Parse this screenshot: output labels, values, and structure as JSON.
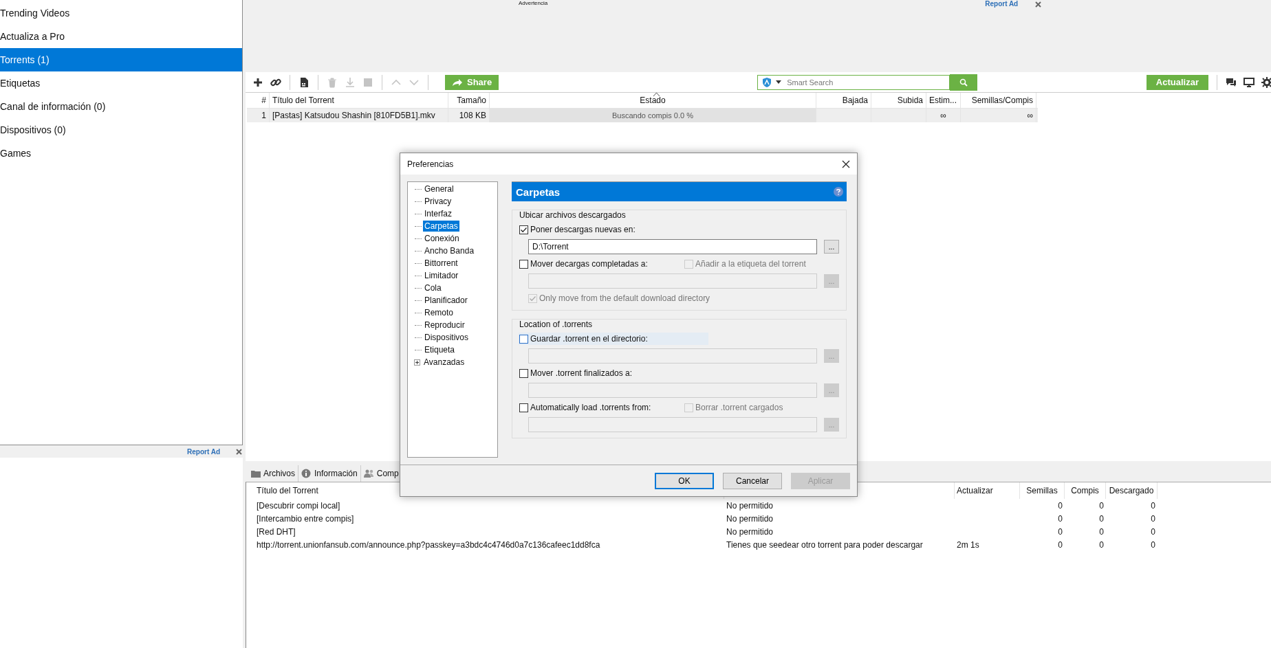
{
  "sidebar": {
    "items": [
      {
        "label": "Trending Videos",
        "selected": false
      },
      {
        "label": "Actualiza a Pro",
        "selected": false
      },
      {
        "label": "Torrents (1)",
        "selected": true
      },
      {
        "label": "Etiquetas",
        "selected": false
      },
      {
        "label": "Canal de información (0)",
        "selected": false
      },
      {
        "label": "Dispositivos (0)",
        "selected": false
      },
      {
        "label": "Games",
        "selected": false
      }
    ],
    "ad": {
      "report": "Report Ad"
    }
  },
  "top_ad": {
    "label": "Advertencia",
    "report": "Report Ad"
  },
  "toolbar": {
    "tools": [
      {
        "kind": "add",
        "disabled": false
      },
      {
        "kind": "link",
        "disabled": false
      },
      {
        "kind": "file",
        "disabled": false
      },
      {
        "kind": "delete",
        "disabled": true
      },
      {
        "kind": "download",
        "disabled": true
      },
      {
        "kind": "stop",
        "disabled": true
      },
      {
        "kind": "up",
        "disabled": true
      },
      {
        "kind": "down",
        "disabled": true
      }
    ],
    "share": "Share",
    "search": {
      "placeholder": "Smart Search"
    },
    "update": "Actualizar"
  },
  "torrent_table": {
    "columns": [
      "#",
      "Título del Torrent",
      "Tamaño",
      "Estado",
      "Bajada",
      "Subida",
      "Estim...",
      "Semillas/Compis"
    ],
    "rows": [
      {
        "cells": [
          "1",
          "[Pastas] Katsudou Shashin [810FD5B1].mkv",
          "108 KB",
          "Buscando compis 0.0 %",
          "",
          "",
          "∞",
          "∞"
        ],
        "selected": false
      }
    ]
  },
  "dialog": {
    "title": "Preferencias",
    "tree": [
      {
        "label": "General",
        "kind": "leaf",
        "selected": false
      },
      {
        "label": "Privacy",
        "kind": "leaf",
        "selected": false
      },
      {
        "label": "Interfaz",
        "kind": "leaf",
        "selected": false
      },
      {
        "label": "Carpetas",
        "kind": "leaf",
        "selected": true
      },
      {
        "label": "Conexión",
        "kind": "leaf",
        "selected": false
      },
      {
        "label": "Ancho Banda",
        "kind": "leaf",
        "selected": false
      },
      {
        "label": "Bittorrent",
        "kind": "leaf",
        "selected": false
      },
      {
        "label": "Limitador",
        "kind": "leaf",
        "selected": false
      },
      {
        "label": "Cola",
        "kind": "leaf",
        "selected": false
      },
      {
        "label": "Planificador",
        "kind": "leaf",
        "selected": false
      },
      {
        "label": "Remoto",
        "kind": "leaf",
        "selected": false
      },
      {
        "label": "Reproducir",
        "kind": "leaf",
        "selected": false
      },
      {
        "label": "Dispositivos",
        "kind": "leaf",
        "selected": false
      },
      {
        "label": "Etiqueta",
        "kind": "leaf",
        "selected": false
      },
      {
        "label": "Avanzadas",
        "kind": "branch",
        "selected": false
      }
    ],
    "heading": "Carpetas",
    "groups": [
      {
        "title": "Ubicar archivos descargados",
        "rows": [
          {
            "kind": "checkbox",
            "label": "Poner descargas nuevas en:",
            "checked": true,
            "disabled": false,
            "focused": false
          },
          {
            "kind": "path",
            "value": "D:\\Torrent",
            "disabled": false,
            "browse": "..."
          },
          {
            "kind": "checkbox",
            "label": "Mover decargas completadas a:",
            "checked": false,
            "disabled": false,
            "focused": false,
            "extra": {
              "label": "Añadir a la etiqueta del torrent",
              "checked": false,
              "disabled": true
            }
          },
          {
            "kind": "path",
            "disabled": true,
            "browse": "..."
          },
          {
            "kind": "subcheck",
            "label": "Only move from the default download directory",
            "checked": true,
            "disabled": true
          }
        ]
      },
      {
        "title": "Location of .torrents",
        "rows": [
          {
            "kind": "checkbox",
            "label": "Guardar .torrent en el directorio:",
            "checked": false,
            "disabled": false,
            "focused": true
          },
          {
            "kind": "path",
            "disabled": true,
            "browse": "..."
          },
          {
            "kind": "checkbox",
            "label": "Mover .torrent finalizados a:",
            "checked": false,
            "disabled": false,
            "focused": false
          },
          {
            "kind": "path",
            "disabled": true,
            "browse": "..."
          },
          {
            "kind": "checkbox",
            "label": "Automatically load .torrents from:",
            "checked": false,
            "disabled": false,
            "focused": false,
            "extra": {
              "label": "Borrar .torrent cargados",
              "checked": false,
              "disabled": true
            }
          },
          {
            "kind": "path",
            "disabled": true,
            "browse": "..."
          }
        ]
      }
    ],
    "buttons": [
      {
        "label": "OK",
        "default": true,
        "disabled": false
      },
      {
        "label": "Cancelar",
        "default": false,
        "disabled": false
      },
      {
        "label": "Aplicar",
        "default": false,
        "disabled": true
      }
    ]
  },
  "bottom_tabs": [
    {
      "label": "Archivos",
      "kind": "files"
    },
    {
      "label": "Información",
      "kind": "info"
    },
    {
      "label": "Comp",
      "kind": "peers"
    }
  ],
  "tracker_table": {
    "columns": [
      "Título del Torrent",
      null,
      "Actualizar",
      "Semillas",
      "Compis",
      "Descargado"
    ],
    "rows": [
      {
        "cells": [
          "[Descubrir compi local]",
          "No permitido",
          "",
          "0",
          "0",
          "0"
        ]
      },
      {
        "cells": [
          "[Intercambio entre compis]",
          "No permitido",
          "",
          "0",
          "0",
          "0"
        ]
      },
      {
        "cells": [
          "[Red DHT]",
          "No permitido",
          "",
          "0",
          "0",
          "0"
        ]
      },
      {
        "cells": [
          "http://torrent.unionfansub.com/announce.php?passkey=a3bdc4c4746d0a7c136cafeec1dd8fca",
          "Tienes que seedear otro torrent para poder descargar",
          "2m 1s",
          "0",
          "0",
          "0"
        ]
      }
    ]
  }
}
